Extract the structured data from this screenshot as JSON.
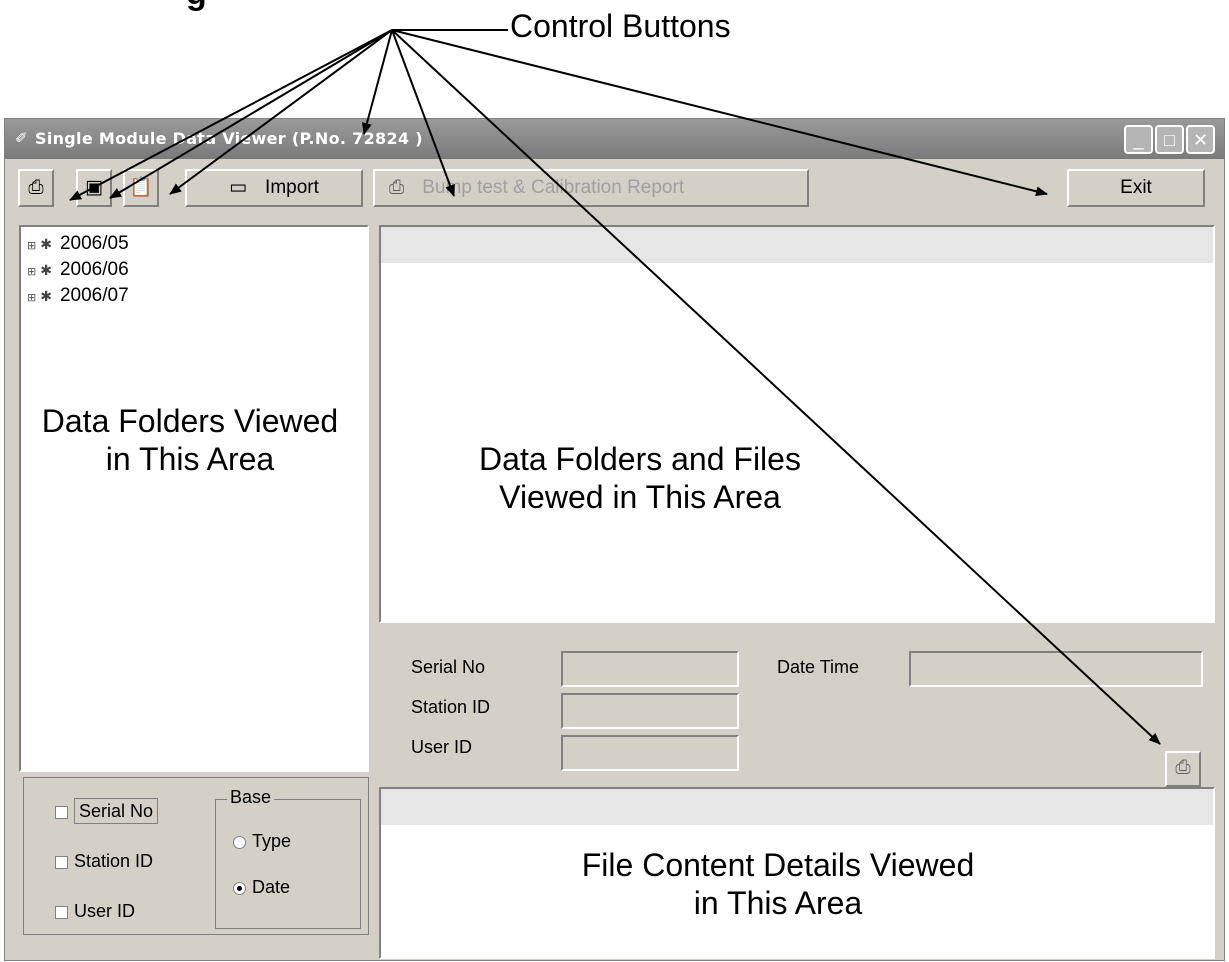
{
  "annotations": {
    "control_buttons": "Control Buttons",
    "tree_area": "Data Folders Viewed in This Area",
    "list_area": "Data Folders and Files Viewed in This Area",
    "content_area": "File Content Details Viewed in This Area"
  },
  "window": {
    "title": "Single Module Data Viewer (P.No. 72824 )",
    "min_label": "_",
    "max_label": "□",
    "close_label": "✕"
  },
  "toolbar": {
    "print_icon": "printer-icon",
    "save_icon": "floppy-icon",
    "clipboard_icon": "clipboard-icon",
    "import_label": "Import",
    "report_label": "Bump test & Calibration Report",
    "exit_label": "Exit"
  },
  "tree": {
    "items": [
      "2006/05",
      "2006/06",
      "2006/07"
    ]
  },
  "details": {
    "serial_label": "Serial No",
    "station_label": "Station ID",
    "user_label": "User ID",
    "datetime_label": "Date Time",
    "serial_value": "",
    "station_value": "",
    "user_value": "",
    "datetime_value": ""
  },
  "filters": {
    "serial": "Serial No",
    "station": "Station ID",
    "user": "User ID",
    "base_label": "Base",
    "type": "Type",
    "date": "Date",
    "selected_base": "Date"
  }
}
